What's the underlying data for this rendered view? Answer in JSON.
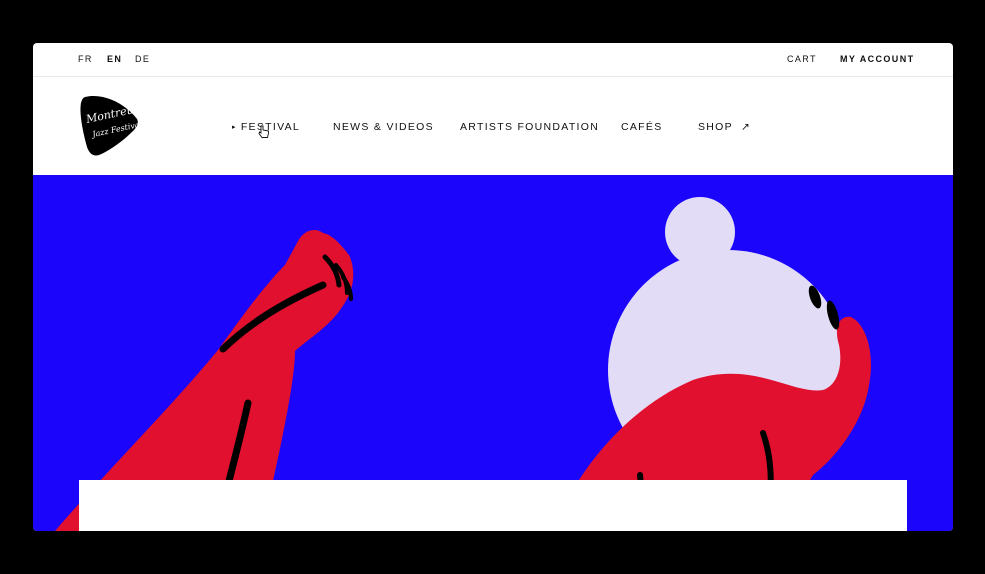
{
  "topbar": {
    "languages": [
      {
        "code": "FR",
        "active": false
      },
      {
        "code": "EN",
        "active": true
      },
      {
        "code": "DE",
        "active": false
      }
    ],
    "cart_label": "CART",
    "account_label": "MY ACCOUNT"
  },
  "logo": {
    "lines": [
      "Montreux",
      "Jazz Festival"
    ]
  },
  "nav": {
    "items": [
      {
        "label": "FESTIVAL",
        "marker": "▸"
      },
      {
        "label": "NEWS & VIDEOS"
      },
      {
        "label": "ARTISTS FOUNDATION"
      },
      {
        "label": "CAFÉS"
      },
      {
        "label": "SHOP",
        "external_icon": "↗"
      }
    ]
  },
  "colors": {
    "hero_background": "#1b06fb",
    "figure_red": "#e0102e",
    "moon_lavender": "#e2dcf6",
    "ink": "#000000"
  }
}
